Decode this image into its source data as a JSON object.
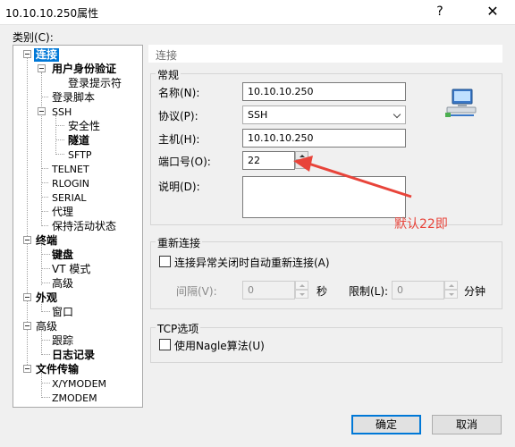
{
  "window": {
    "title": "10.10.10.250属性",
    "help": "?",
    "close": "✕"
  },
  "tree": {
    "label": "类别(C):",
    "items": [
      {
        "label": "连接"
      },
      {
        "label": "用户身份验证"
      },
      {
        "label": "登录提示符"
      },
      {
        "label": "登录脚本"
      },
      {
        "label": "SSH"
      },
      {
        "label": "安全性"
      },
      {
        "label": "隧道"
      },
      {
        "label": "SFTP"
      },
      {
        "label": "TELNET"
      },
      {
        "label": "RLOGIN"
      },
      {
        "label": "SERIAL"
      },
      {
        "label": "代理"
      },
      {
        "label": "保持活动状态"
      },
      {
        "label": "终端"
      },
      {
        "label": "键盘"
      },
      {
        "label": "VT 模式"
      },
      {
        "label": "高级"
      },
      {
        "label": "外观"
      },
      {
        "label": "窗口"
      },
      {
        "label": "高级"
      },
      {
        "label": "跟踪"
      },
      {
        "label": "日志记录"
      },
      {
        "label": "文件传输"
      },
      {
        "label": "X/YMODEM"
      },
      {
        "label": "ZMODEM"
      }
    ]
  },
  "panel": {
    "title": "连接",
    "general": {
      "group": "常规",
      "name_label": "名称(N):",
      "name_value": "10.10.10.250",
      "protocol_label": "协议(P):",
      "protocol_value": "SSH",
      "host_label": "主机(H):",
      "host_value": "10.10.10.250",
      "port_label": "端口号(O):",
      "port_value": "22",
      "desc_label": "说明(D):",
      "desc_value": ""
    },
    "reconnect": {
      "group": "重新连接",
      "checkbox_label": "连接异常关闭时自动重新连接(A)",
      "interval_label": "间隔(V):",
      "interval_value": "0",
      "interval_unit": "秒",
      "limit_label": "限制(L):",
      "limit_value": "0",
      "limit_unit": "分钟"
    },
    "tcp": {
      "group": "TCP选项",
      "nagle_label": "使用Nagle算法(U)"
    }
  },
  "buttons": {
    "ok": "确定",
    "cancel": "取消"
  },
  "annotation": {
    "text": "默认22即",
    "color": "#e8443a"
  }
}
